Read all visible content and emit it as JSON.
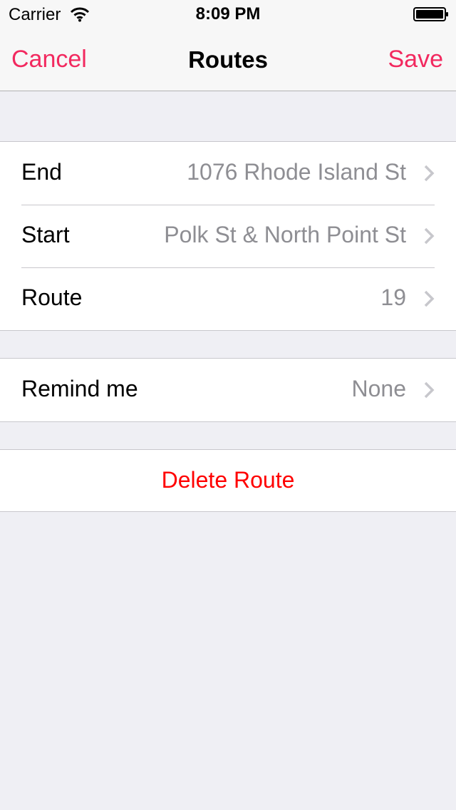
{
  "status_bar": {
    "carrier": "Carrier",
    "time": "8:09 PM"
  },
  "nav": {
    "cancel_label": "Cancel",
    "title": "Routes",
    "save_label": "Save"
  },
  "route_section": {
    "rows": [
      {
        "label": "End",
        "value": "1076 Rhode Island St"
      },
      {
        "label": "Start",
        "value": "Polk St & North Point St"
      },
      {
        "label": "Route",
        "value": "19"
      }
    ]
  },
  "reminder_section": {
    "label": "Remind me",
    "value": "None"
  },
  "delete_section": {
    "label": "Delete Route"
  },
  "colors": {
    "accent": "#f2295f",
    "destructive": "#ff0000",
    "secondary_text": "#8e8e93",
    "background": "#efeff4"
  },
  "icons": {
    "wifi": "wifi-icon",
    "battery": "battery-icon",
    "disclosure": "chevron-right-icon"
  }
}
